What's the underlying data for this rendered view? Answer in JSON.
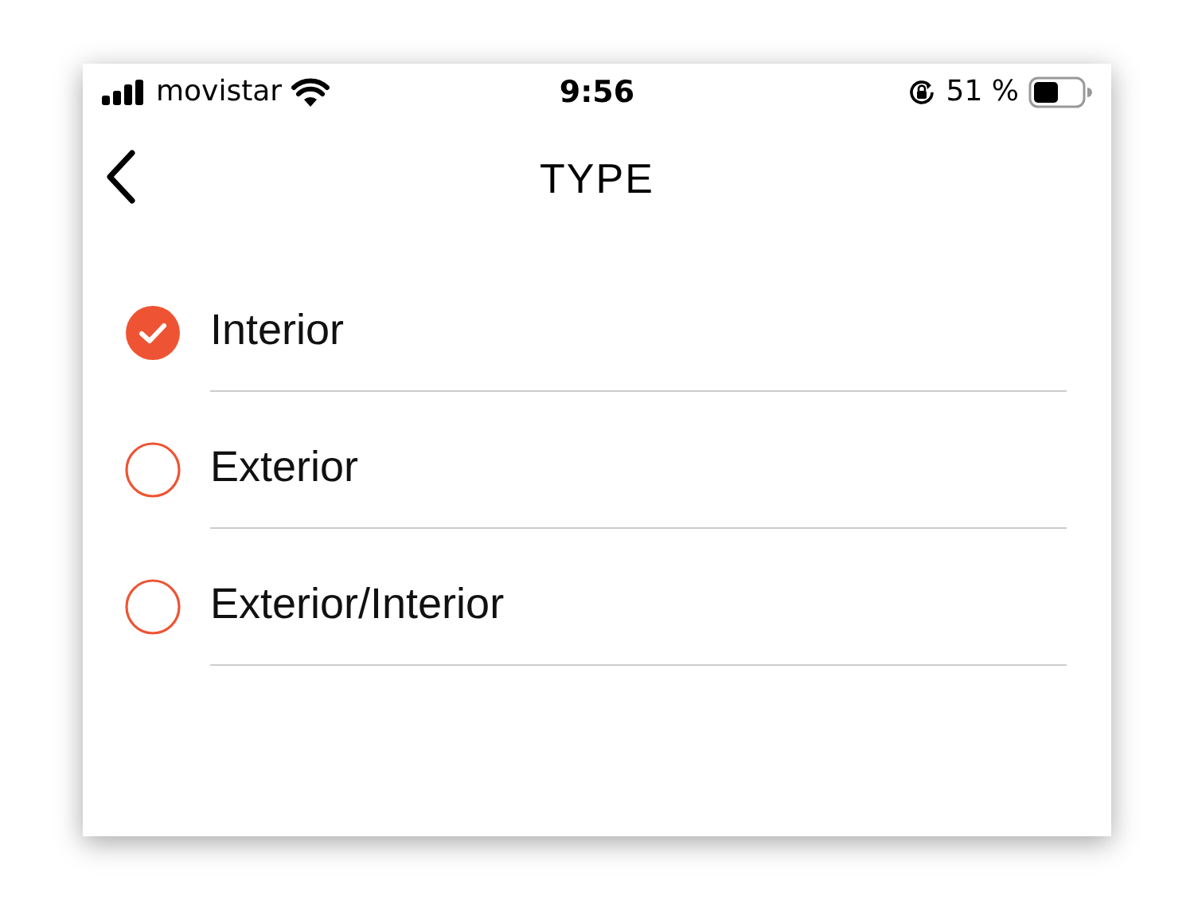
{
  "status_bar": {
    "carrier": "movistar",
    "time": "9:56",
    "battery": "51 %"
  },
  "header": {
    "title": "TYPE"
  },
  "options": [
    {
      "label": "Interior",
      "selected": true
    },
    {
      "label": "Exterior",
      "selected": false
    },
    {
      "label": "Exterior/Interior",
      "selected": false
    }
  ]
}
